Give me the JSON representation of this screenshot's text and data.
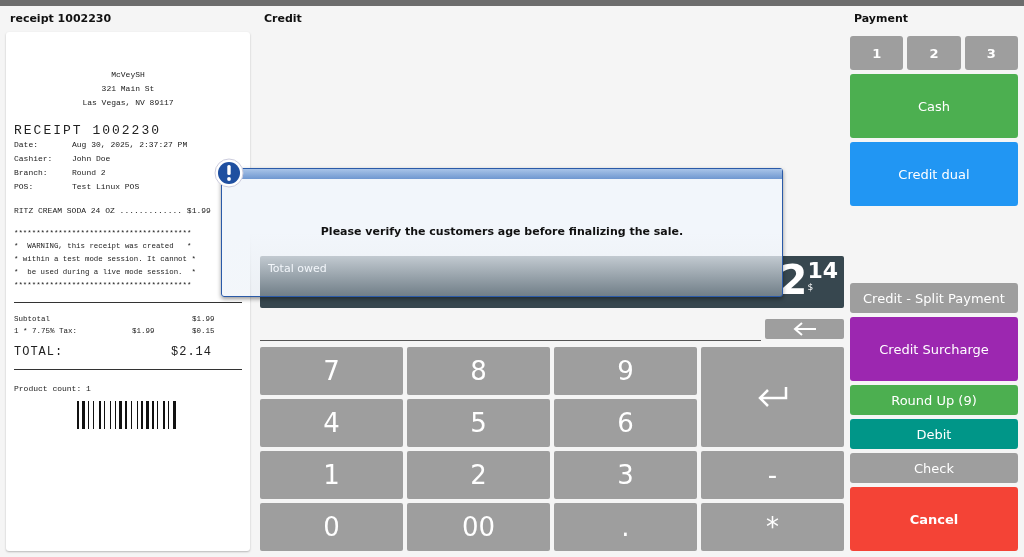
{
  "receipt_panel": {
    "title": "receipt 1002230",
    "header_lines": [
      "McVeySH",
      "321 Main St",
      "Las Vegas, NV 89117"
    ],
    "receipt_title": "RECEIPT 1002230",
    "fields": [
      {
        "label": "Date:",
        "value": "Aug 30, 2025, 2:37:27 PM"
      },
      {
        "label": "Cashier:",
        "value": "John Doe"
      },
      {
        "label": "Branch:",
        "value": "Round 2"
      },
      {
        "label": "POS:",
        "value": "Test Linux POS"
      }
    ],
    "item_line": "RITZ CREAM SODA 24 OZ ............. $1.99",
    "warning_lines": [
      "****************************************",
      "*  WARNING, this receipt was created   *",
      "* within a test mode session. It cannot *",
      "*  be used during a live mode session.  *",
      "****************************************"
    ],
    "subtotal_rows": [
      {
        "label": "Subtotal",
        "amount": "$1.99"
      },
      {
        "label": "1 * 7.75% Tax:",
        "base": "$1.99",
        "amount": "$0.15"
      }
    ],
    "total_label": "TOTAL:",
    "total_value": "$2.14",
    "product_count": "Product count: 1"
  },
  "credit_panel": {
    "title": "Credit",
    "total": {
      "label": "Total owed",
      "whole": "2",
      "cents": "14",
      "currency": "$"
    },
    "keys": [
      {
        "kind": "digit",
        "label": "7"
      },
      {
        "kind": "digit",
        "label": "8"
      },
      {
        "kind": "digit",
        "label": "9"
      },
      {
        "kind": "enter"
      },
      {
        "kind": "digit",
        "label": "4"
      },
      {
        "kind": "digit",
        "label": "5"
      },
      {
        "kind": "digit",
        "label": "6"
      },
      {
        "kind": "digit",
        "label": "1"
      },
      {
        "kind": "digit",
        "label": "2"
      },
      {
        "kind": "digit",
        "label": "3"
      },
      {
        "kind": "digit",
        "label": "-"
      },
      {
        "kind": "digit",
        "label": "0"
      },
      {
        "kind": "digit",
        "label": "00"
      },
      {
        "kind": "digit",
        "label": "."
      },
      {
        "kind": "digit",
        "label": "*"
      }
    ]
  },
  "payment_panel": {
    "title": "Payment",
    "split_buttons": [
      "1",
      "2",
      "3"
    ],
    "buttons": [
      {
        "label": "Cash",
        "color": "#4caf50",
        "kind": "large"
      },
      {
        "label": "Credit dual",
        "color": "#2196f3",
        "kind": "large"
      },
      {
        "label": "Credit - Split Payment",
        "color": "#9e9e9e",
        "kind": "small"
      },
      {
        "label": "Credit Surcharge",
        "color": "#9c27b0",
        "kind": "large"
      },
      {
        "label": "Round Up (9)",
        "color": "#4caf50",
        "kind": "small"
      },
      {
        "label": "Debit",
        "color": "#009688",
        "kind": "small"
      },
      {
        "label": "Check",
        "color": "#9e9e9e",
        "kind": "small"
      },
      {
        "label": "Cancel",
        "color": "#f44336",
        "kind": "large"
      }
    ]
  },
  "dialog": {
    "message": "Please verify the customers age before finalizing the sale."
  }
}
